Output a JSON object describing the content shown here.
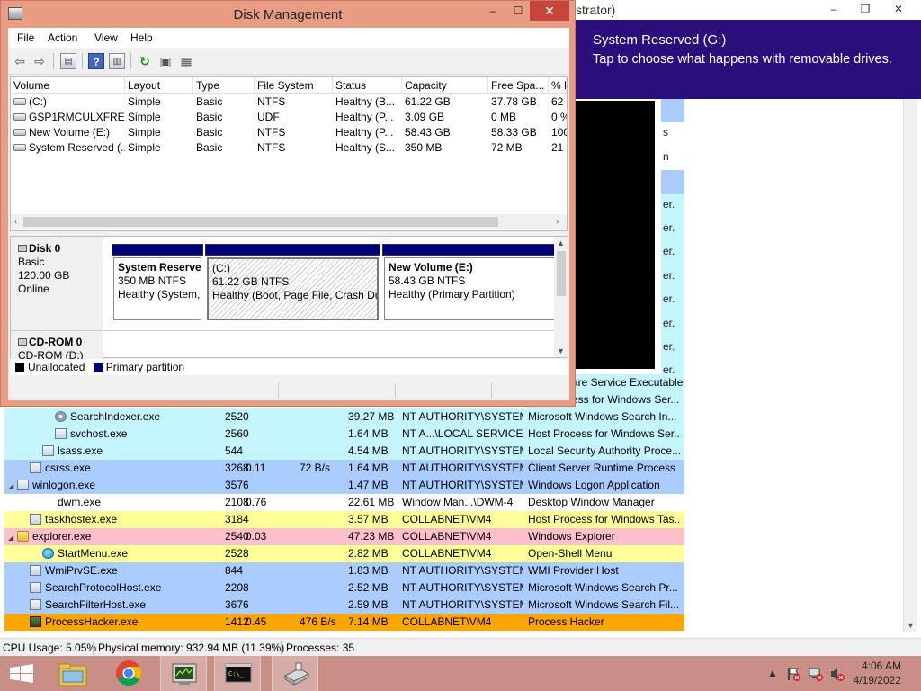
{
  "process_hacker": {
    "title_fragment": "strator)",
    "controls": {
      "minimize": "–",
      "maximize": "❐",
      "close": "✕"
    },
    "right_col_strips": [
      {
        "text": "",
        "color": "#aaccff"
      },
      {
        "text": "s",
        "color": "#ffffff"
      },
      {
        "text": "n",
        "color": "#ffffff"
      },
      {
        "text": "",
        "color": "#aaccff"
      },
      {
        "text": "er.",
        "color": "#c5f5ff"
      },
      {
        "text": "er.",
        "color": "#c5f5ff"
      },
      {
        "text": "er.",
        "color": "#c5f5ff"
      },
      {
        "text": "er.",
        "color": "#c5f5ff"
      },
      {
        "text": "er.",
        "color": "#c5f5ff"
      },
      {
        "text": "er.",
        "color": "#c5f5ff"
      },
      {
        "text": "er.",
        "color": "#c5f5ff"
      },
      {
        "text": "er.",
        "color": "#c5f5ff"
      }
    ],
    "tails": [
      "are Service Executable",
      "ess for Windows Ser..."
    ],
    "rows": [
      {
        "indent": 3,
        "icon": "gear",
        "twisty": "",
        "name": "SearchIndexer.exe",
        "pid": "2520",
        "cpu": "",
        "io": "",
        "mem": "39.27 MB",
        "user": "NT AUTHORITY\\SYSTEM",
        "desc": "Microsoft Windows Search In...",
        "color": "#c5f5ff"
      },
      {
        "indent": 3,
        "icon": "box",
        "twisty": "",
        "name": "svchost.exe",
        "pid": "2560",
        "cpu": "",
        "io": "",
        "mem": "1.64 MB",
        "user": "NT A...\\LOCAL SERVICE",
        "desc": "Host Process for Windows Ser...",
        "color": "#c5f5ff"
      },
      {
        "indent": 2,
        "icon": "box",
        "twisty": "",
        "name": "lsass.exe",
        "pid": "544",
        "cpu": "",
        "io": "",
        "mem": "4.54 MB",
        "user": "NT AUTHORITY\\SYSTEM",
        "desc": "Local Security Authority Proce...",
        "color": "#c5f5ff"
      },
      {
        "indent": 1,
        "icon": "box",
        "twisty": "",
        "name": "csrss.exe",
        "pid": "3268",
        "cpu": "0.11",
        "io": "72 B/s",
        "mem": "1.64 MB",
        "user": "NT AUTHORITY\\SYSTEM",
        "desc": "Client Server Runtime Process",
        "color": "#aaccff"
      },
      {
        "indent": 0,
        "icon": "box",
        "twisty": "◢",
        "name": "winlogon.exe",
        "pid": "3576",
        "cpu": "",
        "io": "",
        "mem": "1.47 MB",
        "user": "NT AUTHORITY\\SYSTEM",
        "desc": "Windows Logon Application",
        "color": "#aaccff"
      },
      {
        "indent": 2,
        "icon": "none",
        "twisty": "",
        "name": "dwm.exe",
        "pid": "2108",
        "cpu": "0.76",
        "io": "",
        "mem": "22.61 MB",
        "user": "Window Man...\\DWM-4",
        "desc": "Desktop Window Manager",
        "color": "#ffffff"
      },
      {
        "indent": 1,
        "icon": "box",
        "twisty": "",
        "name": "taskhostex.exe",
        "pid": "3184",
        "cpu": "",
        "io": "",
        "mem": "3.57 MB",
        "user": "COLLABNET\\VM4",
        "desc": "Host Process for Windows Tas...",
        "color": "#ffff99"
      },
      {
        "indent": 0,
        "icon": "folder",
        "twisty": "◢",
        "name": "explorer.exe",
        "pid": "2540",
        "cpu": "0.03",
        "io": "",
        "mem": "47.23 MB",
        "user": "COLLABNET\\VM4",
        "desc": "Windows Explorer",
        "color": "#ffc0cb"
      },
      {
        "indent": 2,
        "icon": "globe",
        "twisty": "",
        "name": "StartMenu.exe",
        "pid": "2528",
        "cpu": "",
        "io": "",
        "mem": "2.82 MB",
        "user": "COLLABNET\\VM4",
        "desc": "Open-Shell Menu",
        "color": "#ffff99"
      },
      {
        "indent": 1,
        "icon": "box",
        "twisty": "",
        "name": "WmiPrvSE.exe",
        "pid": "844",
        "cpu": "",
        "io": "",
        "mem": "1.83 MB",
        "user": "NT AUTHORITY\\SYSTEM",
        "desc": "WMI Provider Host",
        "color": "#aaccff"
      },
      {
        "indent": 1,
        "icon": "box",
        "twisty": "",
        "name": "SearchProtocolHost.exe",
        "pid": "2208",
        "cpu": "",
        "io": "",
        "mem": "2.52 MB",
        "user": "NT AUTHORITY\\SYSTEM",
        "desc": "Microsoft Windows Search Pr...",
        "color": "#aaccff"
      },
      {
        "indent": 1,
        "icon": "box",
        "twisty": "",
        "name": "SearchFilterHost.exe",
        "pid": "3676",
        "cpu": "",
        "io": "",
        "mem": "2.59 MB",
        "user": "NT AUTHORITY\\SYSTEM",
        "desc": "Microsoft Windows Search Fil...",
        "color": "#aaccff"
      },
      {
        "indent": 1,
        "icon": "ph",
        "twisty": "",
        "name": "ProcessHacker.exe",
        "pid": "1412",
        "cpu": "0.45",
        "io": "476 B/s",
        "mem": "7.14 MB",
        "user": "COLLABNET\\VM4",
        "desc": "Process Hacker",
        "color": "#ffa500"
      }
    ],
    "statusbar": {
      "cpu": "CPU Usage: 5.05%",
      "memory": "Physical memory: 932.94 MB (11.39%)",
      "processes": "Processes: 35"
    }
  },
  "toast": {
    "title": "System Reserved (G:)",
    "body": "Tap to choose what happens with removable drives."
  },
  "disk_management": {
    "title": "Disk Management",
    "controls": {
      "minimize": "–",
      "maximize": "☐",
      "close": "✕"
    },
    "menu": [
      "File",
      "Action",
      "View",
      "Help"
    ],
    "columns": [
      "Volume",
      "Layout",
      "Type",
      "File System",
      "Status",
      "Capacity",
      "Free Spa...",
      "% F"
    ],
    "volumes": [
      {
        "volume": "(C:)",
        "layout": "Simple",
        "type": "Basic",
        "fs": "NTFS",
        "status": "Healthy (B...",
        "capacity": "61.22 GB",
        "free": "37.78 GB",
        "pct": "62"
      },
      {
        "volume": "GSP1RMCULXFRE...",
        "layout": "Simple",
        "type": "Basic",
        "fs": "UDF",
        "status": "Healthy (P...",
        "capacity": "3.09 GB",
        "free": "0 MB",
        "pct": "0 %"
      },
      {
        "volume": "New Volume (E:)",
        "layout": "Simple",
        "type": "Basic",
        "fs": "NTFS",
        "status": "Healthy (P...",
        "capacity": "58.43 GB",
        "free": "58.33 GB",
        "pct": "100"
      },
      {
        "volume": "System Reserved (...",
        "layout": "Simple",
        "type": "Basic",
        "fs": "NTFS",
        "status": "Healthy (S...",
        "capacity": "350 MB",
        "free": "72 MB",
        "pct": "21"
      }
    ],
    "disk0": {
      "name": "Disk 0",
      "type": "Basic",
      "size": "120.00 GB",
      "state": "Online",
      "partitions": [
        {
          "name": "System Reserve",
          "size": "350 MB NTFS",
          "status": "Healthy (System,"
        },
        {
          "name": "(C:)",
          "size": "61.22 GB NTFS",
          "status": "Healthy (Boot, Page File, Crash Du"
        },
        {
          "name": "New Volume  (E:)",
          "size": "58.43 GB NTFS",
          "status": "Healthy (Primary Partition)"
        }
      ]
    },
    "cdrom": {
      "name": "CD-ROM 0",
      "sub": "CD-ROM (D:)"
    },
    "legend": {
      "unallocated": "Unallocated",
      "primary": "Primary partition"
    },
    "colors": {
      "unallocated": "#000000",
      "primary": "#00007a"
    }
  },
  "taskbar": {
    "time": "4:06 AM",
    "date": "4/19/2022"
  }
}
